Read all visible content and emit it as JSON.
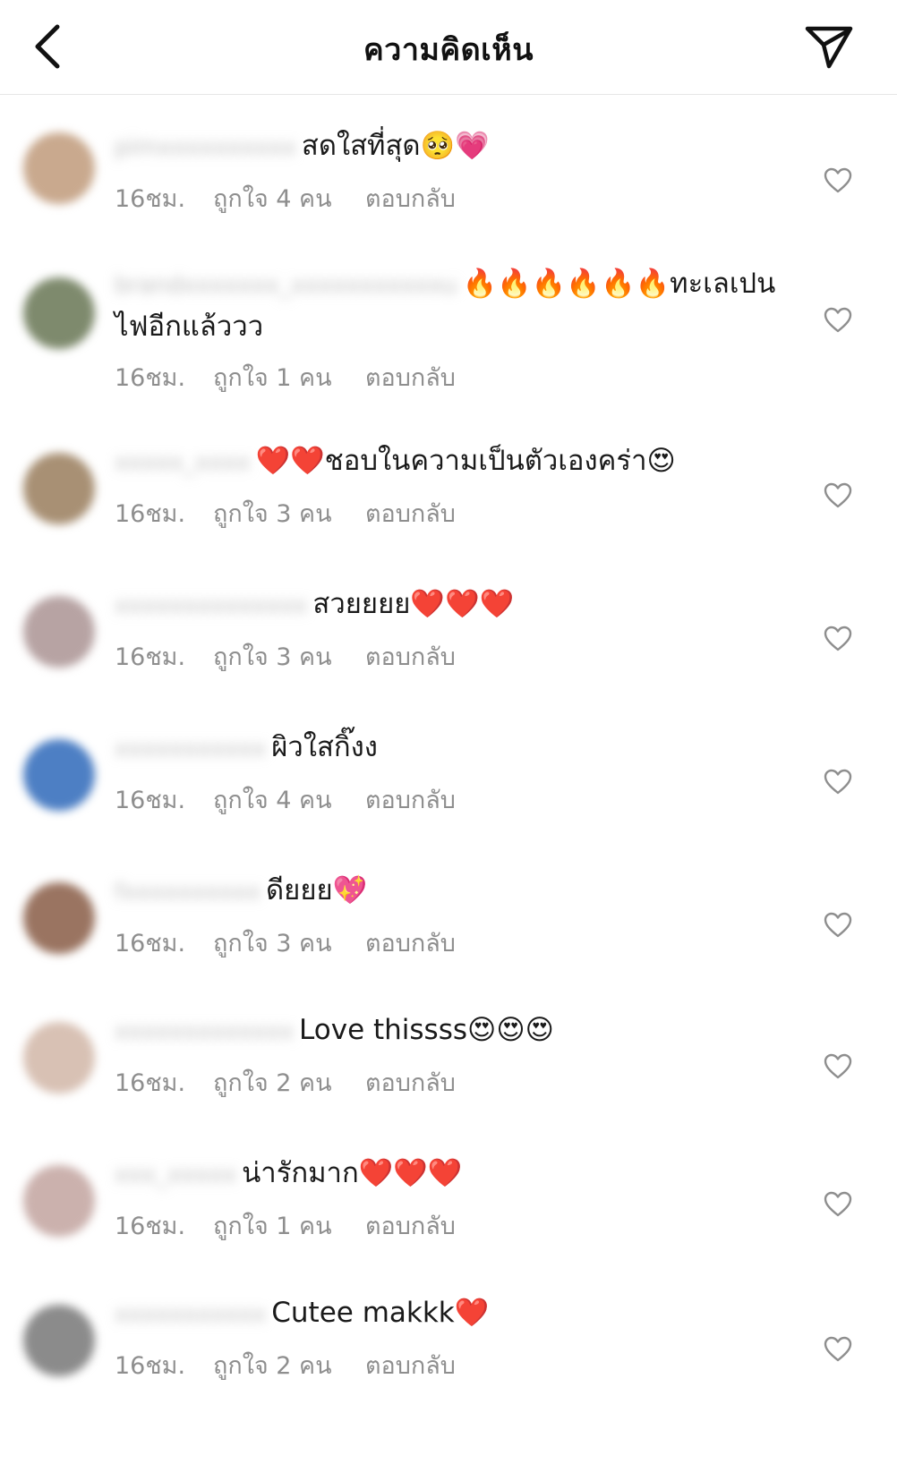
{
  "header": {
    "title": "ความคิดเห็น",
    "back_icon": "chevron-left-icon",
    "send_icon": "paper-plane-icon"
  },
  "comments": [
    {
      "username": "pimxxxxxxxxxx",
      "text": "สดใสที่สุด🥺💗",
      "time": "16ชม.",
      "likes": "ถูกใจ 4 คน",
      "reply": "ตอบกลับ",
      "avatar_color": "#c9a98e"
    },
    {
      "username": "brandxxxxxxx_xxxxxxxxxxxu",
      "text": "🔥🔥🔥🔥🔥🔥ทะเลเปนไฟอีกแล้ววว",
      "time": "16ชม.",
      "likes": "ถูกใจ 1 คน",
      "reply": "ตอบกลับ",
      "avatar_color": "#7e8a6d"
    },
    {
      "username": "xxxxx_xxxx",
      "text": "❤️❤️ชอบในความเป็นตัวเองคร่า😍",
      "time": "16ชม.",
      "likes": "ถูกใจ 3 คน",
      "reply": "ตอบกลับ",
      "avatar_color": "#a89074"
    },
    {
      "username": "xxxxxxxxxxxxxx",
      "text": "สวยยยย❤️❤️❤️",
      "time": "16ชม.",
      "likes": "ถูกใจ 3 คน",
      "reply": "ตอบกลับ",
      "avatar_color": "#b7a3a3"
    },
    {
      "username": "xxxxxxxxxxx",
      "text": "ผิวใสกิ๊งง",
      "time": "16ชม.",
      "likes": "ถูกใจ 4 คน",
      "reply": "ตอบกลับ",
      "avatar_color": "#4d7fc4"
    },
    {
      "username": "fxxxxxxxxxx",
      "text": "ดียยย💖",
      "time": "16ชม.",
      "likes": "ถูกใจ 3 คน",
      "reply": "ตอบกลับ",
      "avatar_color": "#9a7461"
    },
    {
      "username": "xxxxxxxxxxxxx",
      "text": "Love thissss😍😍😍",
      "time": "16ชม.",
      "likes": "ถูกใจ 2 คน",
      "reply": "ตอบกลับ",
      "avatar_color": "#d8c1b4"
    },
    {
      "username": "xxx_xxxxx",
      "text": "น่ารักมาก❤️❤️❤️",
      "time": "16ชม.",
      "likes": "ถูกใจ 1 คน",
      "reply": "ตอบกลับ",
      "avatar_color": "#cbb1ad"
    },
    {
      "username": "xxxxxxxxxxx",
      "text": "Cutee makkk❤️",
      "time": "16ชม.",
      "likes": "ถูกใจ 2 คน",
      "reply": "ตอบกลับ",
      "avatar_color": "#8b8b8b"
    }
  ],
  "heart_icon": "heart-outline-icon"
}
